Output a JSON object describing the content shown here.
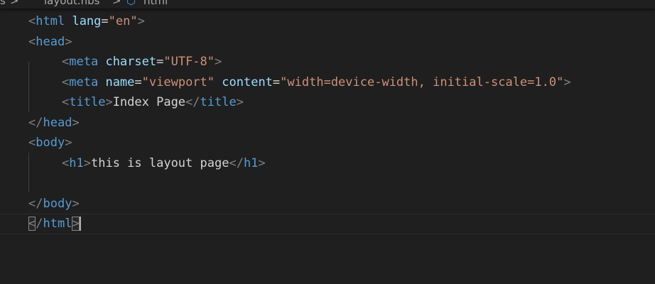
{
  "breadcrumb": {
    "items": [
      "s",
      "layout.hbs",
      "html"
    ],
    "separator": ">"
  },
  "colors": {
    "background": "#1f1f1f",
    "tag": "#569cd6",
    "attribute": "#9cdcfe",
    "string": "#ce9178",
    "punctuation": "#808080",
    "text": "#d4d4d4"
  },
  "icons": {
    "breadcrumb_element": "html-element-icon"
  },
  "code": {
    "html_tag": "html",
    "lang_attr": "lang",
    "lang_value": "\"en\"",
    "head_tag": "head",
    "meta_tag": "meta",
    "charset_attr": "charset",
    "charset_value": "\"UTF-8\"",
    "name_attr": "name",
    "name_value": "\"viewport\"",
    "content_attr": "content",
    "content_value": "\"width=device-width, initial-scale=1.0\"",
    "title_tag": "title",
    "title_text": "Index Page",
    "body_tag": "body",
    "h1_tag": "h1",
    "h1_text": "this is layout page"
  }
}
